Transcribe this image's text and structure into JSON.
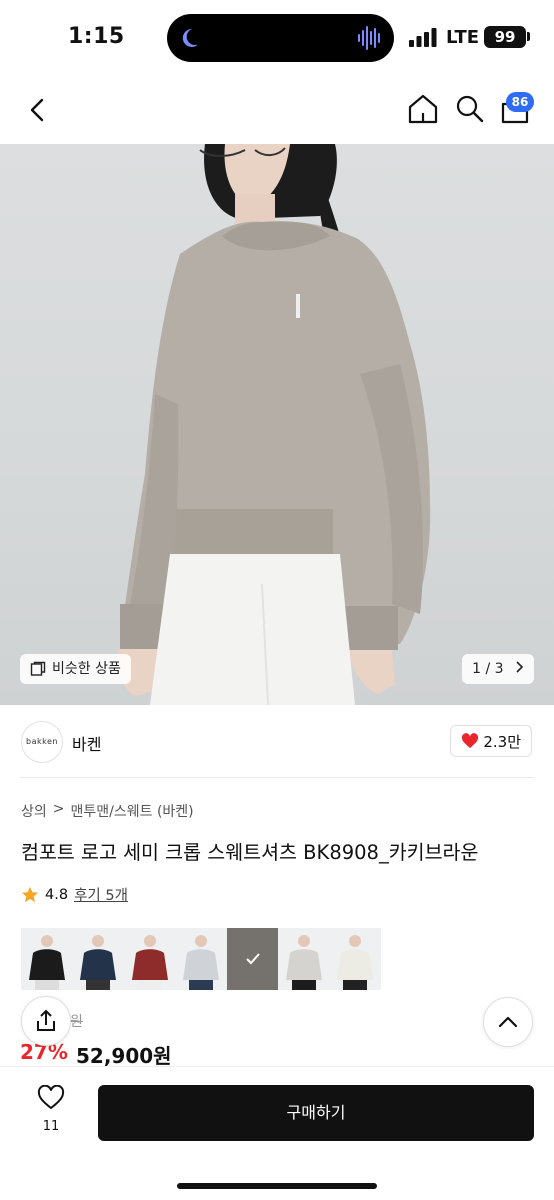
{
  "status_bar": {
    "time": "1:15",
    "network": "LTE",
    "battery": "99"
  },
  "nav": {
    "cart_count": "86"
  },
  "hero": {
    "similar_label": "비슷한 상품",
    "pager": "1 / 3"
  },
  "brand": {
    "logo_text": "bakken",
    "name": "바켄",
    "likes": "2.3만"
  },
  "breadcrumb": [
    "상의",
    ">",
    "맨투맨/스웨트 (바켄)"
  ],
  "product": {
    "title": "컴포트 로고 세미 크롭 스웨트셔츠 BK8908_카키브라운",
    "rating": "4.8",
    "review_link": "후기 5개"
  },
  "colors": {
    "accent_blue": "#2f6cf5",
    "discount_red": "#e8262b",
    "star": "#f5a623"
  },
  "price": {
    "original": "원",
    "discount": "27%",
    "sale": "52,900원"
  },
  "bottom": {
    "wish_count": "11",
    "buy_label": "구매하기"
  }
}
